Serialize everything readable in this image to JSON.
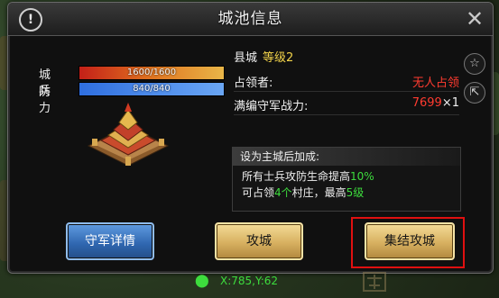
{
  "title": "城池信息",
  "stats": {
    "defense": {
      "label": "城防",
      "text": "1600/1600",
      "fraction": 1.0
    },
    "troops": {
      "label": "兵力",
      "text": "840/840",
      "fraction": 1.0
    }
  },
  "city": {
    "name": "县城",
    "level": "等级2",
    "occupant_label": "占领者:",
    "occupant_value": "无人占领",
    "garrison_label": "满编守军战力:",
    "garrison_value": "7699",
    "garrison_multiplier": "×1"
  },
  "bonus": {
    "header": "设为主城后加成:",
    "line1_prefix": "所有士兵攻防生命提高",
    "line1_value": "10%",
    "line2_a": "可占领",
    "line2_b": "4个",
    "line2_c": "村庄，最高",
    "line2_d": "5级"
  },
  "buttons": {
    "garrison_details": "守军详情",
    "attack": "攻城",
    "rally_attack": "集结攻城"
  },
  "coordinates": "X:785,Y:62",
  "icons": {
    "info": "info-icon",
    "close": "close-icon",
    "favorite": "star-icon",
    "share": "share-icon",
    "location": "location-pin-icon"
  },
  "colors": {
    "accent_red": "#ff3b30",
    "accent_green": "#3ddc3d",
    "level_gold": "#f2d34a",
    "highlight_red": "#e01010"
  }
}
